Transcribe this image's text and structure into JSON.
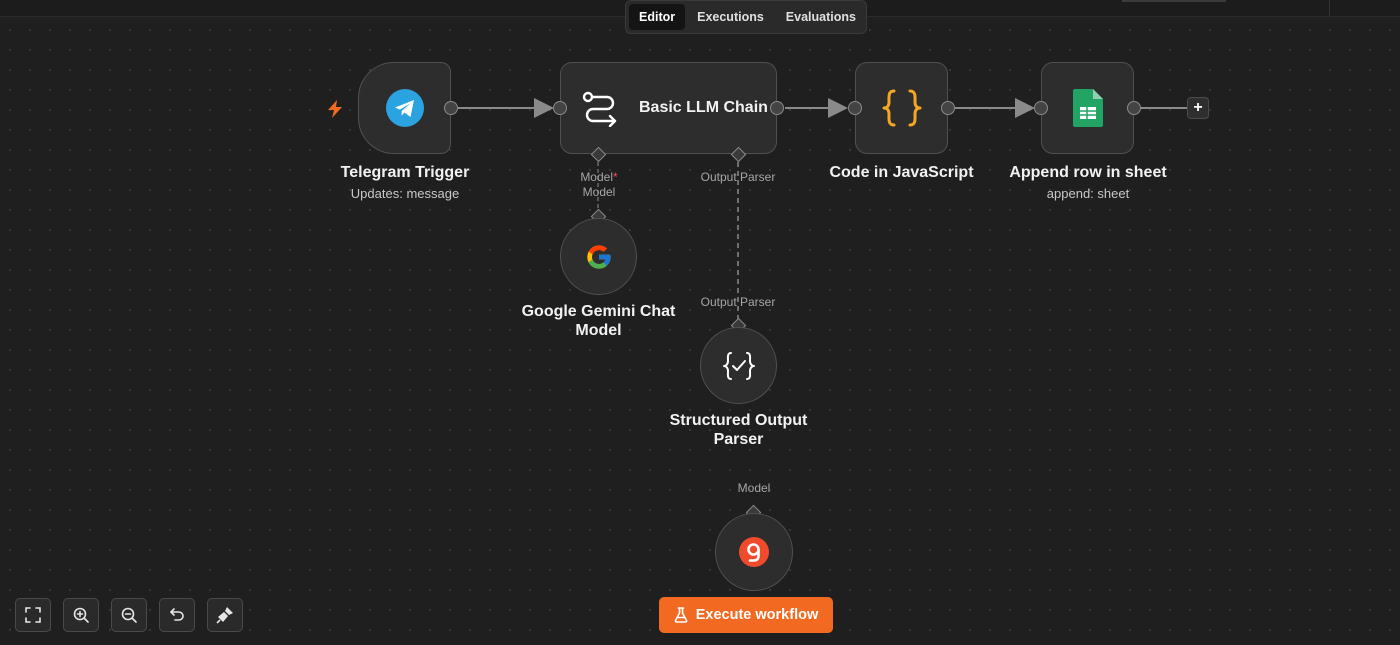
{
  "tabs": {
    "editor": "Editor",
    "executions": "Executions",
    "evaluations": "Evaluations",
    "active": "Editor"
  },
  "nodes": {
    "telegram": {
      "title": "Telegram Trigger",
      "subtitle": "Updates: message",
      "icon": "telegram-icon"
    },
    "llm_chain": {
      "title": "Basic LLM Chain",
      "icon": "llm-chain-icon"
    },
    "code": {
      "title": "Code in JavaScript",
      "icon": "code-braces-icon"
    },
    "sheet": {
      "title": "Append row in sheet",
      "subtitle": "append: sheet",
      "icon": "google-sheets-icon"
    },
    "gemini": {
      "title_line1": "Google Gemini Chat",
      "title_line2": "Model",
      "icon": "google-icon"
    },
    "parser": {
      "title_line1": "Structured Output",
      "title_line2": "Parser",
      "icon": "structured-output-icon"
    },
    "model3": {
      "icon": "model-provider-icon"
    }
  },
  "labels": {
    "model_required": "Model",
    "required_mark": "*",
    "model": "Model",
    "output_parser": "Output Parser",
    "output_parser_2": "Output Parser",
    "model_3": "Model"
  },
  "add_node": "+",
  "execute_button": "Execute workflow",
  "toolbar": [
    "fit-view-icon",
    "zoom-in-icon",
    "zoom-out-icon",
    "reset-zoom-icon",
    "tidy-up-icon"
  ],
  "colors": {
    "accent": "#f26a21",
    "telegram": "#2aa3e0",
    "code": "#f5a623",
    "sheets": "#21a464"
  }
}
